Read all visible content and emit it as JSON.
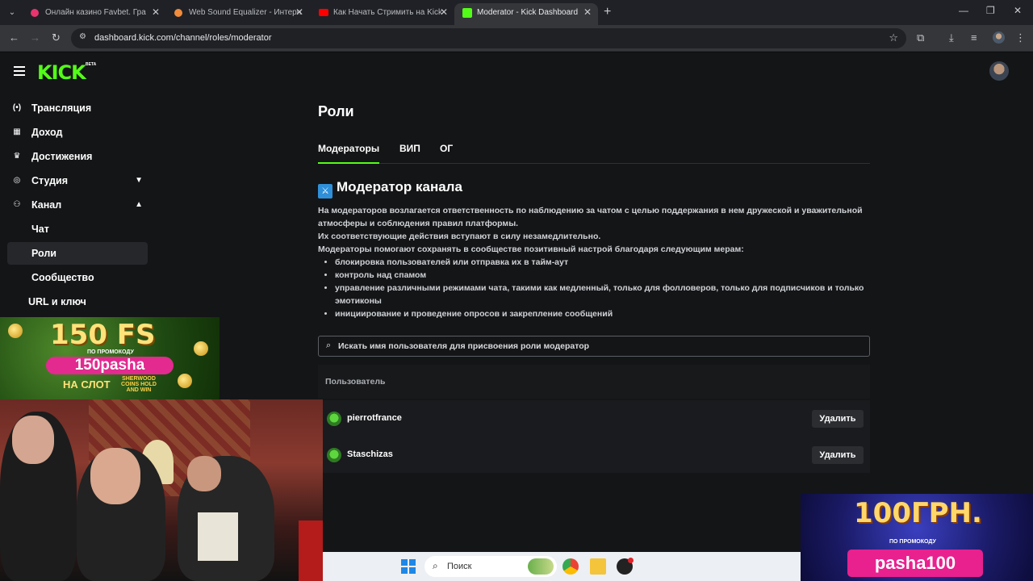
{
  "browser": {
    "tabs": [
      {
        "title": "Онлайн казино Favbet. Гра",
        "favicon_color": "#e8356e"
      },
      {
        "title": "Web Sound Equalizer - Интерн",
        "favicon_color": "#f28b3c"
      },
      {
        "title": "Как Начать Стримить на Kick",
        "favicon_color": "#ff0000"
      },
      {
        "title": "Moderator - Kick Dashboard",
        "favicon_color": "#53fc18"
      }
    ],
    "active_tab": 3,
    "url": "dashboard.kick.com/channel/roles/moderator"
  },
  "kick": {
    "logo": "KICK",
    "beta": "BETA",
    "accent": "#53fc18"
  },
  "sidebar": {
    "items": [
      {
        "label": "Трансляция",
        "icon": "broadcast-icon"
      },
      {
        "label": "Доход",
        "icon": "revenue-icon"
      },
      {
        "label": "Достижения",
        "icon": "trophy-icon"
      },
      {
        "label": "Студия",
        "icon": "studio-icon",
        "chevron": "down"
      },
      {
        "label": "Канал",
        "icon": "channel-icon",
        "chevron": "up"
      }
    ],
    "subitems": [
      {
        "label": "Чат"
      },
      {
        "label": "Роли",
        "active": true
      },
      {
        "label": "Сообщество"
      },
      {
        "label": "URL и ключ трансляции"
      }
    ]
  },
  "main": {
    "title": "Роли",
    "tabs": [
      {
        "label": "Модераторы",
        "active": true
      },
      {
        "label": "ВИП"
      },
      {
        "label": "ОГ"
      }
    ],
    "section_title": "Модератор канала",
    "description": [
      "На модераторов возлагается ответственность по наблюдению за чатом с целью поддержания в нем дружеской и уважительной атмосферы и соблюдения правил платформы.",
      "Их соответствующие действия вступают в силу незамедлительно.",
      "Модераторы помогают сохранять в сообществе позитивный настрой благодаря следующим мерам:"
    ],
    "bullets": [
      "блокировка пользователей или отправка их в тайм-аут",
      "контроль над спамом",
      "управление различными режимами чата, такими как медленный, только для фолловеров, только для подписчиков и только эмотиконы",
      "инициирование и проведение опросов и закрепление сообщений"
    ],
    "search_placeholder": "Искать имя пользователя для присвоения роли модератор",
    "table_header": "Пользователь",
    "users": [
      {
        "name": "pierrotfrance",
        "action": "Удалить"
      },
      {
        "name": "Staschizas",
        "action": "Удалить"
      }
    ]
  },
  "overlays": {
    "promo_left": {
      "big": "150 FS",
      "small": "ПО ПРОМОКОДУ",
      "code": "150pasha",
      "slot": "НА СЛОТ",
      "game": "SHERWOOD COINS HOLD AND WIN"
    },
    "promo_right": {
      "big": "100ГРН.",
      "small": "ПО ПРОМОКОДУ",
      "code": "pasha100"
    }
  },
  "taskbar": {
    "search_label": "Поиск"
  }
}
